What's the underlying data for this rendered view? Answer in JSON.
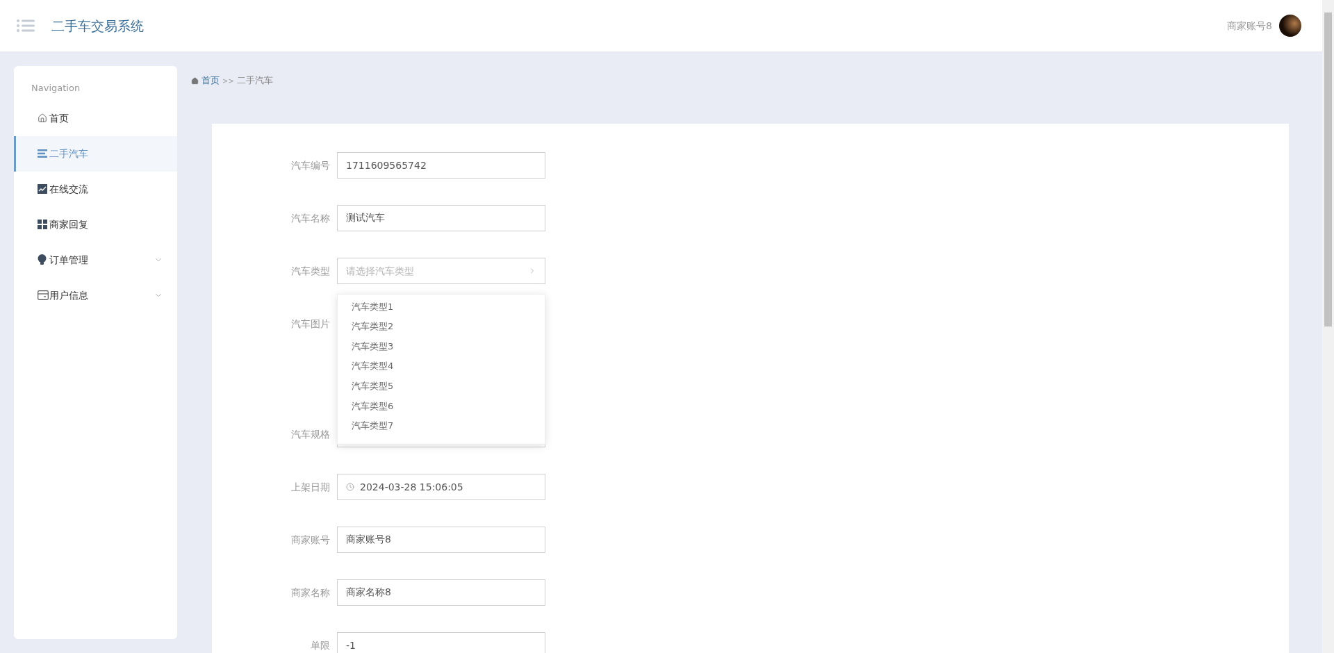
{
  "header": {
    "title": "二手车交易系统",
    "user_name": "商家账号8"
  },
  "sidebar": {
    "heading": "Navigation",
    "items": [
      {
        "label": "首页",
        "kind": "home",
        "selected": false,
        "expandable": false
      },
      {
        "label": "二手汽车",
        "kind": "list",
        "selected": true,
        "expandable": false
      },
      {
        "label": "在线交流",
        "kind": "chart",
        "selected": false,
        "expandable": false
      },
      {
        "label": "商家回复",
        "kind": "grid",
        "selected": false,
        "expandable": false
      },
      {
        "label": "订单管理",
        "kind": "bulb",
        "selected": false,
        "expandable": true
      },
      {
        "label": "用户信息",
        "kind": "card",
        "selected": false,
        "expandable": true
      }
    ]
  },
  "breadcrumb": {
    "home": "首页",
    "separator": ">>",
    "current": "二手汽车"
  },
  "form": {
    "fields": [
      {
        "label": "汽车编号",
        "kind": "text",
        "value": "1711609565742"
      },
      {
        "label": "汽车名称",
        "kind": "text",
        "value": "测试汽车"
      },
      {
        "label": "汽车类型",
        "kind": "select",
        "placeholder": "请选择汽车类型",
        "open": true,
        "options": [
          "汽车类型1",
          "汽车类型2",
          "汽车类型3",
          "汽车类型4",
          "汽车类型5",
          "汽车类型6",
          "汽车类型7"
        ]
      },
      {
        "label": "汽车图片",
        "kind": "upload"
      },
      {
        "label": "汽车规格",
        "kind": "text"
      },
      {
        "label": "上架日期",
        "kind": "datetime",
        "value": "2024-03-28 15:06:05"
      },
      {
        "label": "商家账号",
        "kind": "text",
        "value": "商家账号8"
      },
      {
        "label": "商家名称",
        "kind": "text",
        "value": "商家名称8"
      },
      {
        "label": "单限",
        "kind": "text",
        "value": "-1"
      }
    ]
  }
}
